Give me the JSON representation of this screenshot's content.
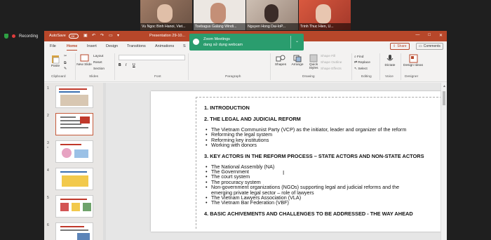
{
  "participants": [
    {
      "name": "Vu Ngoc Binh Hanoi, Viet...",
      "color": "#8a6d5a"
    },
    {
      "name": "Toebagus Galang Windi...",
      "color": "#e9e4df"
    },
    {
      "name": "Nguyen Hong Dai-IoP...",
      "color": "#b9a79a"
    },
    {
      "name": "Trinh Thuc Hien, U...",
      "color": "#c94a3a"
    }
  ],
  "recording": {
    "label": "Recording"
  },
  "ppt": {
    "titlebar": {
      "autosave": "AutoSave",
      "toggle": "Off",
      "filename": "Presentation 29-10..."
    },
    "tabs": [
      "File",
      "Home",
      "Insert",
      "Design",
      "Transitions",
      "Animations",
      "S"
    ],
    "active_tab": "Home",
    "share": "Share",
    "comments": "Comments",
    "ribbon": {
      "paste": "Paste",
      "new_slide": "New Slide",
      "layout": "Layout",
      "reset": "Reset",
      "section": "Section",
      "shapes": "Shapes",
      "arrange": "Arrange",
      "quick_styles": "Quick Styles",
      "shape_fill": "Shape Fill",
      "shape_outline": "Shape Outline",
      "shape_effects": "Shape Effects",
      "find": "Find",
      "replace": "Replace",
      "select": "Select",
      "dictate": "Dictate",
      "design_ideas": "Design Ideas",
      "groups": {
        "clipboard": "Clipboard",
        "slides": "Slides",
        "font": "Font",
        "paragraph": "Paragraph",
        "drawing": "Drawing",
        "editing": "Editing",
        "voice": "Voice",
        "designer": "Designer"
      }
    },
    "zoom_notice": {
      "title": "Zoom Meetings",
      "message": "dang sử dụng webcam"
    },
    "thumbnails": [
      {
        "num": "1",
        "star": ""
      },
      {
        "num": "2",
        "star": ""
      },
      {
        "num": "3",
        "star": "*"
      },
      {
        "num": "4",
        "star": ""
      },
      {
        "num": "5",
        "star": ""
      },
      {
        "num": "6",
        "star": ""
      }
    ],
    "slide": {
      "h1": "1.  INTRODUCTION",
      "h2": "2.  THE LEGAL AND JUDICIAL REFORM",
      "list2": [
        "The Vietnam Communist Party (VCP) as the initiator, leader and organizer of the reform",
        "Reforming the legal system",
        "Reforming key institutions",
        "Working with donors"
      ],
      "h3": "3.   KEY ACTORS IN THE REFORM PROCESS – STATE ACTORS AND NON-STATE ACTORS",
      "list3": [
        "The National Assembly (NA)",
        "The Government",
        "The court system",
        "The procuracy system",
        "Non-government organizations (NGOs) supporting legal and judicial reforms and the"
      ],
      "list3_cont": "emerging private legal sector – role of lawyers",
      "list3b": [
        "The Vietnam Lawyers Association (VLA)",
        "The Vietnam Bar Federation (VBF)"
      ],
      "h4": "4.   BASIC ACHIVEMENTS AND CHALLENGES TO BE ADDRESSED - THE WAY AHEAD"
    }
  }
}
